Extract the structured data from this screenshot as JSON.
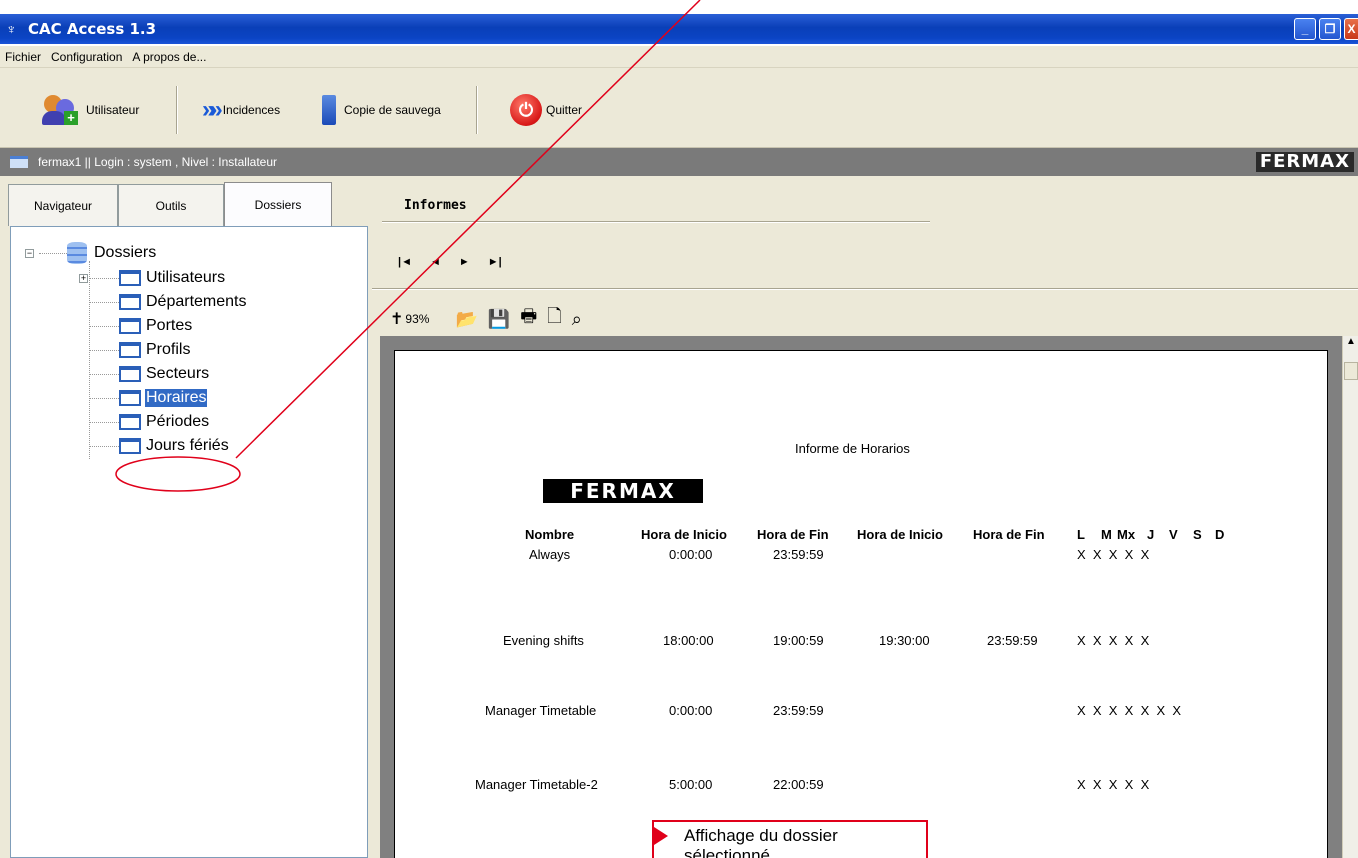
{
  "window": {
    "title": "CAC Access 1.3"
  },
  "menu": {
    "items": [
      "Fichier",
      "Configuration",
      "A propos de..."
    ]
  },
  "toolbar": {
    "user_label": "Utilisateur",
    "incidents_label": "Incidences",
    "backup_label": "Copie de sauvega",
    "quit_label": "Quitter"
  },
  "status": {
    "text": "fermax1  || Login : system , Nivel : Installateur",
    "brand": "FERMAX"
  },
  "tabs": [
    "Navigateur",
    "Outils",
    "Dossiers"
  ],
  "tree": {
    "root": "Dossiers",
    "items": [
      "Utilisateurs",
      "Départements",
      "Portes",
      "Profils",
      "Secteurs",
      "Horaires",
      "Périodes",
      "Jours fériés"
    ],
    "selected": "Horaires"
  },
  "report": {
    "tab_title": "Informes",
    "nav_first": "|◄",
    "nav_prev": "◄",
    "nav_next": "►",
    "nav_last": "►|",
    "zoom": "93%",
    "paper_title": "Informe de Horarios",
    "logo": "FERMAX",
    "columns": [
      "Nombre",
      "Hora de Inicio",
      "Hora de Fin",
      "Hora de Inicio",
      "Hora de Fin",
      "L",
      "M",
      "Mx",
      "J",
      "V",
      "S",
      "D"
    ],
    "rows": [
      {
        "name": "Always",
        "start1": "0:00:00",
        "end1": "23:59:59",
        "start2": "",
        "end2": "",
        "days": "X  X  X  X  X"
      },
      {
        "name": "Evening shifts",
        "start1": "18:00:00",
        "end1": "19:00:59",
        "start2": "19:30:00",
        "end2": "23:59:59",
        "days": "X  X  X  X  X"
      },
      {
        "name": "Manager Timetable",
        "start1": "0:00:00",
        "end1": "23:59:59",
        "start2": "",
        "end2": "",
        "days": "X  X  X  X  X  X  X"
      },
      {
        "name": "Manager Timetable-2",
        "start1": "5:00:00",
        "end1": "22:00:59",
        "start2": "",
        "end2": "",
        "days": "X  X  X  X  X"
      }
    ]
  },
  "annotation": {
    "callout_text": "Affichage du dossier sélectionné",
    "color": "#e0001a"
  },
  "colors": {
    "titlebar": "#0a3fb8",
    "selection": "#316ac5",
    "panel": "#ece9d8"
  }
}
